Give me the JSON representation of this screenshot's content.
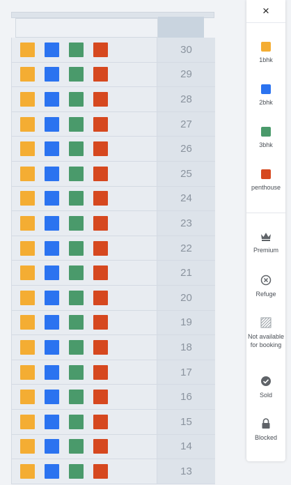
{
  "colors": {
    "bhk1": "#f4ad33",
    "bhk2": "#2b73f0",
    "bhk3": "#4a9a6b",
    "penthouse": "#d6481f"
  },
  "floors": [
    "30",
    "29",
    "28",
    "27",
    "26",
    "25",
    "24",
    "23",
    "22",
    "21",
    "20",
    "19",
    "18",
    "17",
    "16",
    "15",
    "14",
    "13"
  ],
  "panel": {
    "close_label": "×",
    "legend": [
      {
        "label": "1bhk",
        "color": "#f4ad33"
      },
      {
        "label": "2bhk",
        "color": "#2b73f0"
      },
      {
        "label": "3bhk",
        "color": "#4a9a6b"
      },
      {
        "label": "penthouse",
        "color": "#d6481f"
      }
    ],
    "symbols": [
      {
        "label": "Premium",
        "icon": "crown-icon"
      },
      {
        "label": "Refuge",
        "icon": "x-circle-icon"
      },
      {
        "label": "Not available for booking",
        "icon": "hatch-icon"
      },
      {
        "label": "Sold",
        "icon": "check-circle-icon"
      },
      {
        "label": "Blocked",
        "icon": "lock-icon"
      }
    ]
  }
}
